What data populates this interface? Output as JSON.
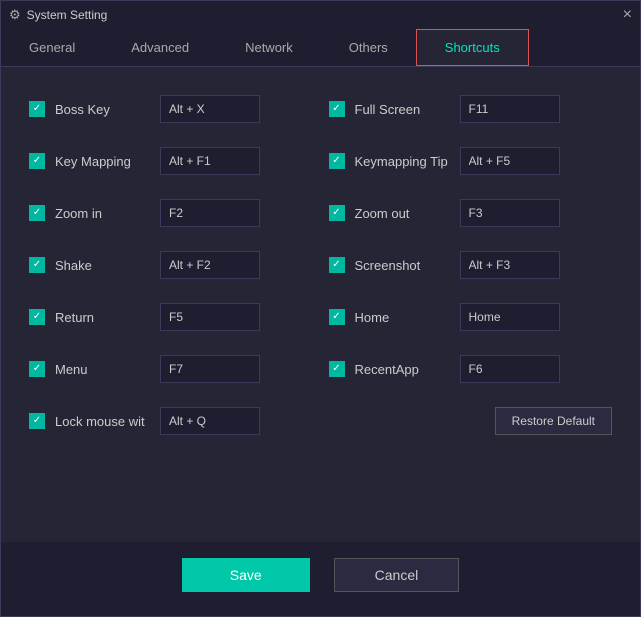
{
  "window": {
    "title": "System Setting",
    "close_label": "×"
  },
  "tabs": [
    {
      "id": "general",
      "label": "General",
      "active": false
    },
    {
      "id": "advanced",
      "label": "Advanced",
      "active": false
    },
    {
      "id": "network",
      "label": "Network",
      "active": false
    },
    {
      "id": "others",
      "label": "Others",
      "active": false
    },
    {
      "id": "shortcuts",
      "label": "Shortcuts",
      "active": true
    }
  ],
  "shortcuts": {
    "left": [
      {
        "id": "boss-key",
        "label": "Boss Key",
        "value": "Alt + X",
        "checked": true
      },
      {
        "id": "key-mapping",
        "label": "Key Mapping",
        "value": "Alt + F1",
        "checked": true
      },
      {
        "id": "zoom-in",
        "label": "Zoom in",
        "value": "F2",
        "checked": true
      },
      {
        "id": "shake",
        "label": "Shake",
        "value": "Alt + F2",
        "checked": true
      },
      {
        "id": "return",
        "label": "Return",
        "value": "F5",
        "checked": true
      },
      {
        "id": "menu",
        "label": "Menu",
        "value": "F7",
        "checked": true
      },
      {
        "id": "lock-mouse",
        "label": "Lock mouse wit",
        "value": "Alt + Q",
        "checked": true
      }
    ],
    "right": [
      {
        "id": "full-screen",
        "label": "Full Screen",
        "value": "F11",
        "checked": true
      },
      {
        "id": "keymapping-tip",
        "label": "Keymapping Tip",
        "value": "Alt + F5",
        "checked": true
      },
      {
        "id": "zoom-out",
        "label": "Zoom out",
        "value": "F3",
        "checked": true
      },
      {
        "id": "screenshot",
        "label": "Screenshot",
        "value": "Alt + F3",
        "checked": true
      },
      {
        "id": "home",
        "label": "Home",
        "value": "Home",
        "checked": true
      },
      {
        "id": "recent-app",
        "label": "RecentApp",
        "value": "F6",
        "checked": true
      }
    ],
    "restore_default_label": "Restore Default"
  },
  "footer": {
    "save_label": "Save",
    "cancel_label": "Cancel"
  }
}
